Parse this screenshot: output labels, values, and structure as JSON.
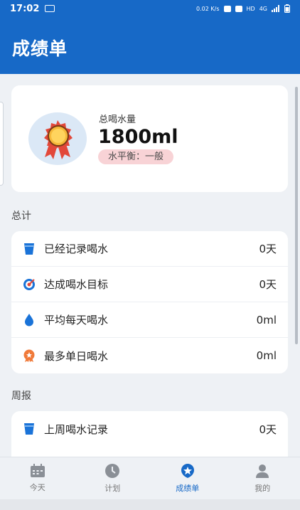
{
  "status_bar": {
    "time": "17:02",
    "net_speed": "0.02 K/s",
    "signal": "4G",
    "hd": "HD"
  },
  "app_bar": {
    "title": "成绩单"
  },
  "summary": {
    "label": "总喝水量",
    "value": "1800ml",
    "level": "水平衡：一般"
  },
  "sections": {
    "total": {
      "title": "总计",
      "rows": [
        {
          "label": "已经记录喝水",
          "value": "0天",
          "icon": "cup-icon"
        },
        {
          "label": "达成喝水目标",
          "value": "0天",
          "icon": "target-icon"
        },
        {
          "label": "平均每天喝水",
          "value": "0ml",
          "icon": "water-drop-icon"
        },
        {
          "label": "最多单日喝水",
          "value": "0ml",
          "icon": "award-icon"
        }
      ]
    },
    "weekly": {
      "title": "周报",
      "rows": [
        {
          "label": "上周喝水记录",
          "value": "0天",
          "icon": "cup-icon"
        }
      ]
    }
  },
  "nav": {
    "items": [
      {
        "label": "今天",
        "icon": "calendar-icon"
      },
      {
        "label": "计划",
        "icon": "clock-icon"
      },
      {
        "label": "成绩单",
        "icon": "star-badge-icon"
      },
      {
        "label": "我的",
        "icon": "person-icon"
      }
    ],
    "active": "成绩单"
  },
  "colors": {
    "primary": "#1769c7",
    "background": "#eef1f5",
    "badge_bg": "#f8d3d6",
    "icon_blue": "#1a73d8",
    "icon_orange": "#f07a3a"
  }
}
